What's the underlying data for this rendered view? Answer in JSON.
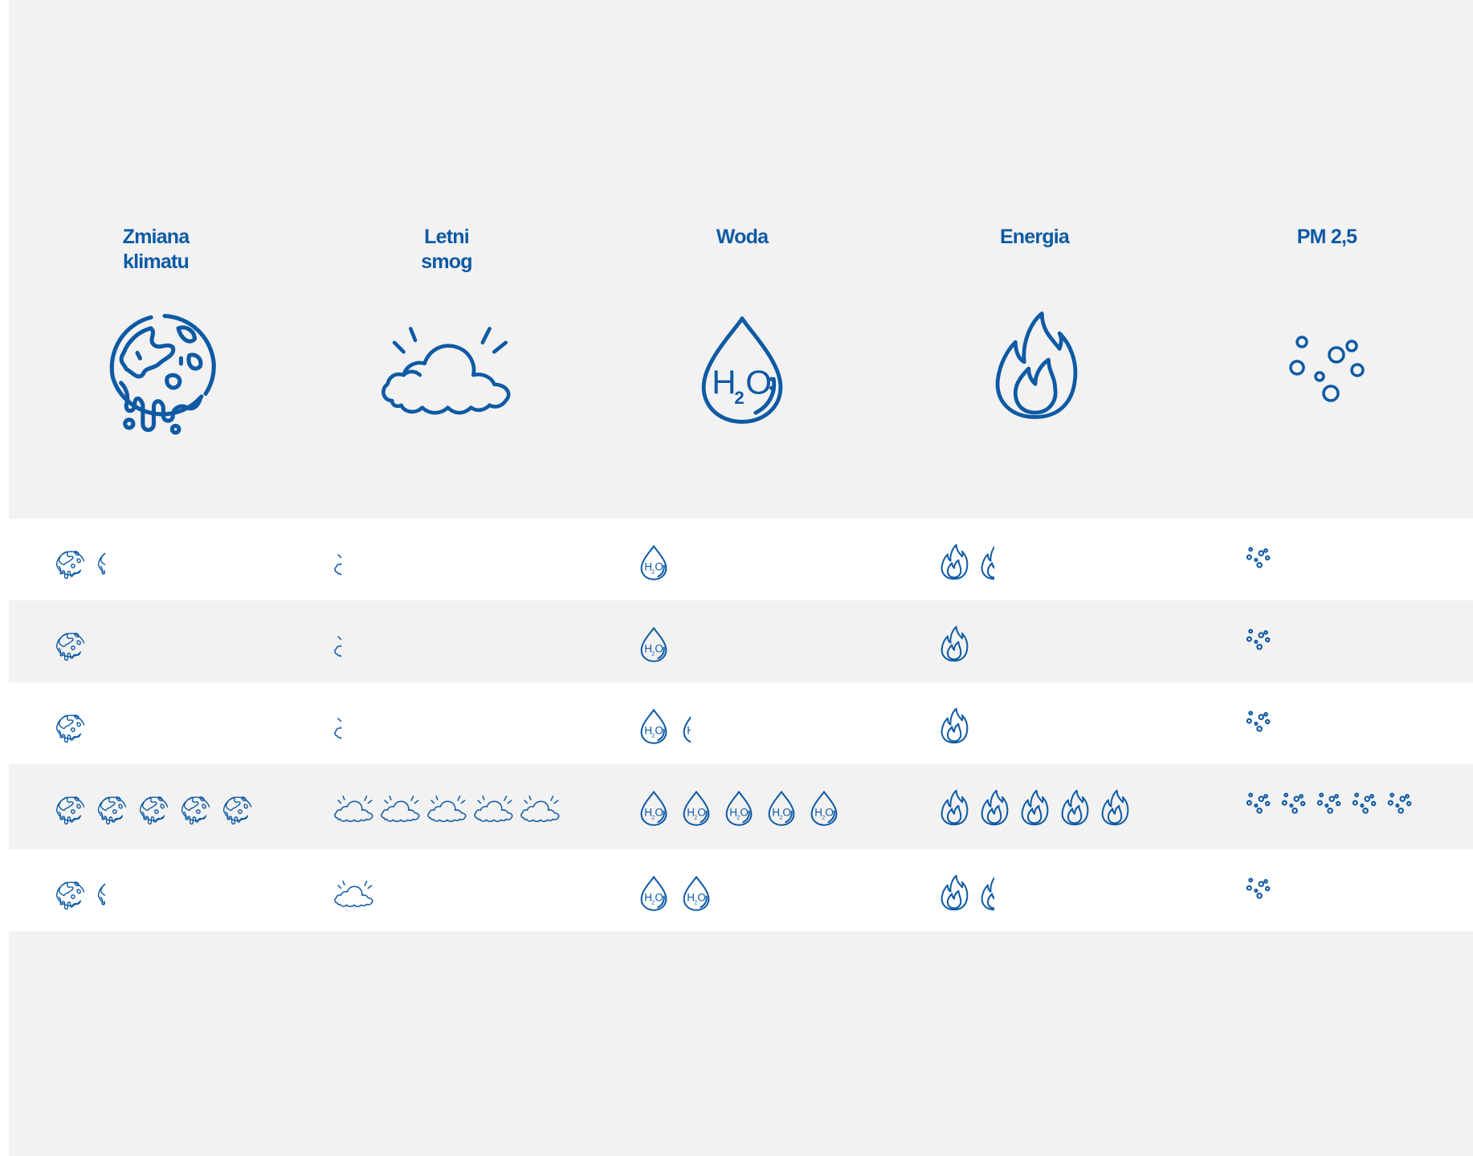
{
  "columns": [
    {
      "key": "climate",
      "title": "Zmiana\nklimatu",
      "icon": "melting-globe-icon"
    },
    {
      "key": "smog",
      "title": "Letni\nsmog",
      "icon": "cloud-sun-icon"
    },
    {
      "key": "water",
      "title": "Woda",
      "icon": "water-drop-h2o-icon"
    },
    {
      "key": "energy",
      "title": "Energia",
      "icon": "flame-icon"
    },
    {
      "key": "pm",
      "title": "PM 2,5",
      "icon": "particles-icon"
    }
  ],
  "water_icon_text": {
    "h": "H",
    "sub": "2",
    "o": "O"
  },
  "rows": [
    {
      "climate": 1.3,
      "smog": 0.2,
      "water": 1,
      "energy": 1.5,
      "pm": 1
    },
    {
      "climate": 1,
      "smog": 0.2,
      "water": 1,
      "energy": 1,
      "pm": 1
    },
    {
      "climate": 1,
      "smog": 0.2,
      "water": 1.3,
      "energy": 1,
      "pm": 1
    },
    {
      "climate": 5,
      "smog": 5,
      "water": 5,
      "energy": 5,
      "pm": 5
    },
    {
      "climate": 1.3,
      "smog": 1,
      "water": 2,
      "energy": 1.5,
      "pm": 1
    }
  ],
  "colors": {
    "accent": "#0e5aa4",
    "band_grey": "#f2f2f2",
    "band_white": "#ffffff"
  }
}
